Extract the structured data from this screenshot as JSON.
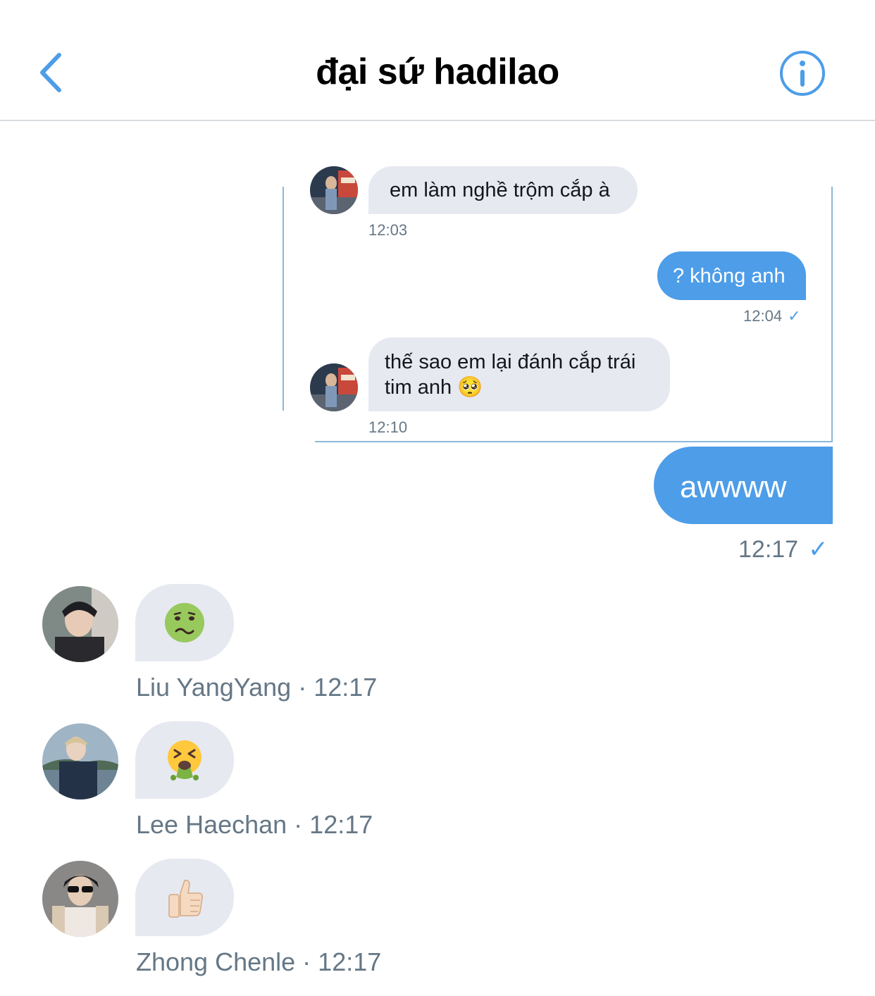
{
  "header": {
    "title": "đại sứ hadilao"
  },
  "quoted_thread": [
    {
      "direction": "in",
      "text": "em làm nghề trộm cắp à",
      "time": "12:03"
    },
    {
      "direction": "out",
      "text": "? không anh",
      "time": "12:04",
      "check": "✓"
    },
    {
      "direction": "in",
      "text_line1": "thế sao em lại đánh cắp trái",
      "text_line2": "tim anh 🥺",
      "time": "12:10"
    }
  ],
  "reply": {
    "text": "awwww",
    "time": "12:17",
    "check": "✓"
  },
  "reactions": [
    {
      "sender": "Liu YangYang",
      "time": "12:17",
      "separator": " · ",
      "emoji_icon": "nauseated-face"
    },
    {
      "sender": "Lee Haechan",
      "time": "12:17",
      "separator": " · ",
      "emoji_icon": "vomiting-face"
    },
    {
      "sender": "Zhong Chenle",
      "time": "12:17",
      "separator": " · ",
      "emoji_icon": "thumbs-up"
    }
  ],
  "colors": {
    "accent": "#4d9de8",
    "bubble_in": "#e6e9f0",
    "meta_text": "#657786"
  }
}
